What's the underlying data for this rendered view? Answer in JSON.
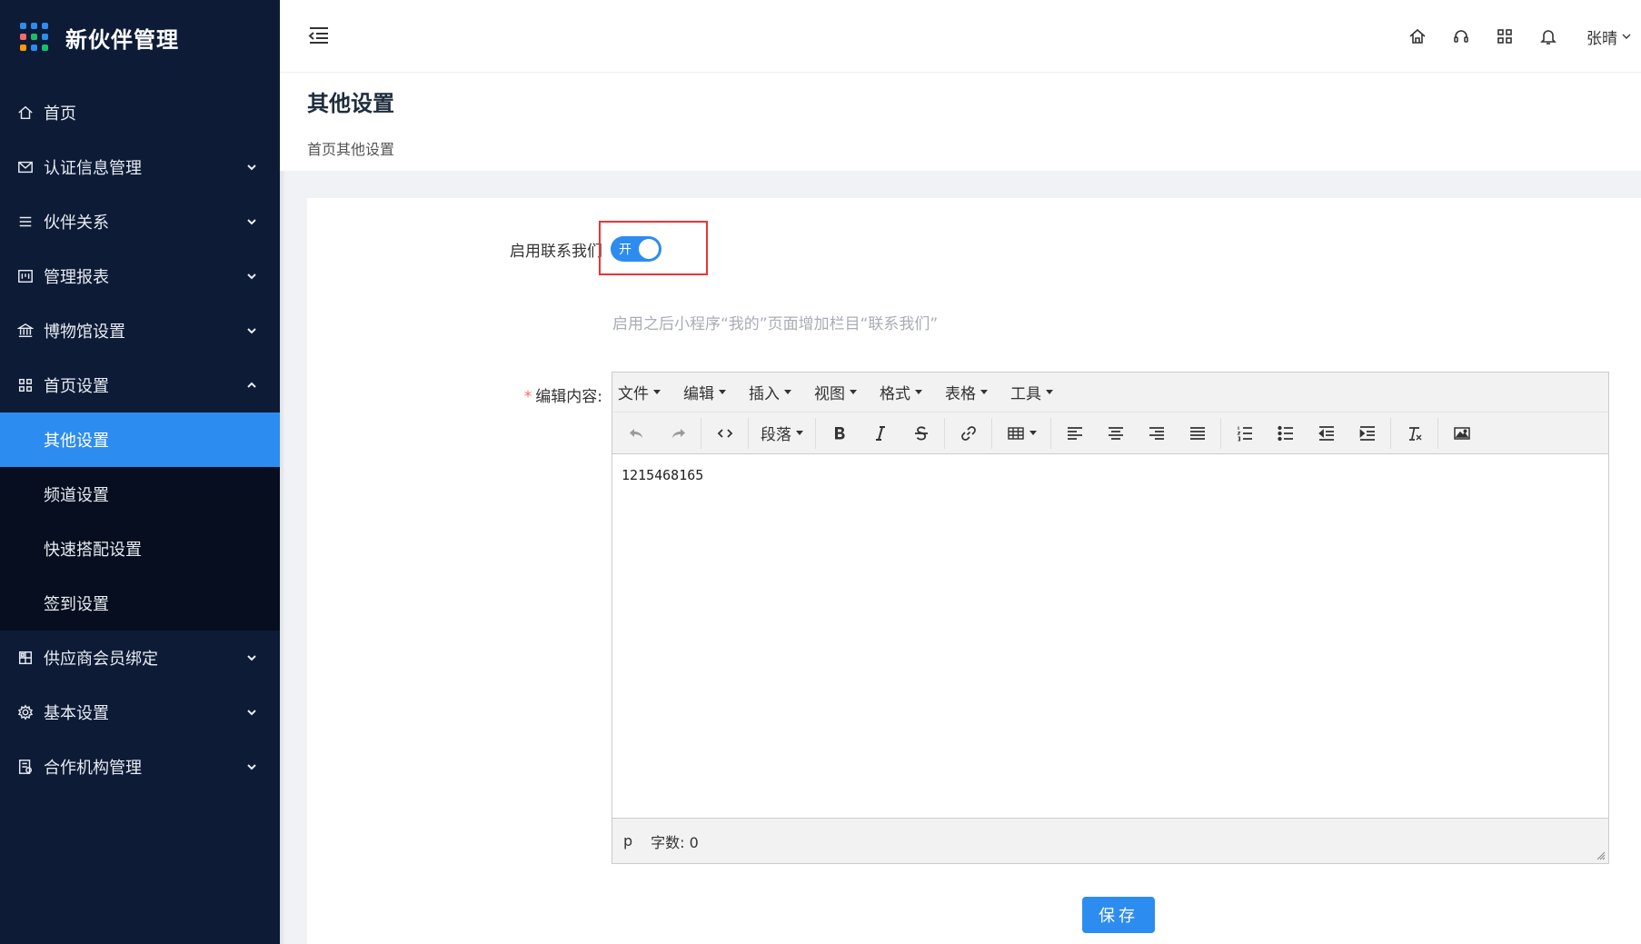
{
  "app": {
    "title": "新伙伴管理",
    "logo_colors": [
      "#2d8cf0",
      "#2d8cf0",
      "#2d8cf0",
      "#f56c6c",
      "#19be6b",
      "#2d8cf0",
      "#ff9900",
      "#2d8cf0",
      "#19be6b"
    ]
  },
  "sidebar": {
    "items": [
      {
        "label": "首页",
        "icon": "home-icon",
        "has_children": false
      },
      {
        "label": "认证信息管理",
        "icon": "mail-icon",
        "has_children": true
      },
      {
        "label": "伙伴关系",
        "icon": "list-icon",
        "has_children": true
      },
      {
        "label": "管理报表",
        "icon": "report-icon",
        "has_children": true
      },
      {
        "label": "博物馆设置",
        "icon": "museum-icon",
        "has_children": true
      },
      {
        "label": "首页设置",
        "icon": "grid-icon",
        "has_children": true,
        "expanded": true
      },
      {
        "label": "供应商会员绑定",
        "icon": "bind-icon",
        "has_children": true
      },
      {
        "label": "基本设置",
        "icon": "gear-icon",
        "has_children": true
      },
      {
        "label": "合作机构管理",
        "icon": "org-icon",
        "has_children": true
      }
    ],
    "submenu": [
      {
        "label": "其他设置",
        "active": true
      },
      {
        "label": "频道设置"
      },
      {
        "label": "快速搭配设置"
      },
      {
        "label": "签到设置"
      }
    ],
    "active_color": "#2d8cf0",
    "bg_color": "#0d1b36"
  },
  "header": {
    "user_name": "张晴",
    "icons": [
      "home-icon",
      "headset-icon",
      "apps-icon",
      "bell-icon"
    ]
  },
  "page": {
    "title": "其他设置",
    "subtitle": "首页其他设置"
  },
  "form": {
    "contact_label": "启用联系我们",
    "switch_text": "开",
    "switch_on": true,
    "hint": "启用之后小程序“我的”页面增加栏目“联系我们”",
    "content_label": "编辑内容:",
    "content_required_mark": "*",
    "save_label": "保存"
  },
  "editor": {
    "menus": [
      "文件",
      "编辑",
      "插入",
      "视图",
      "格式",
      "表格",
      "工具"
    ],
    "paragraph_label": "段落",
    "content": "1215468165",
    "status_path": "p",
    "word_count": "字数: 0"
  }
}
